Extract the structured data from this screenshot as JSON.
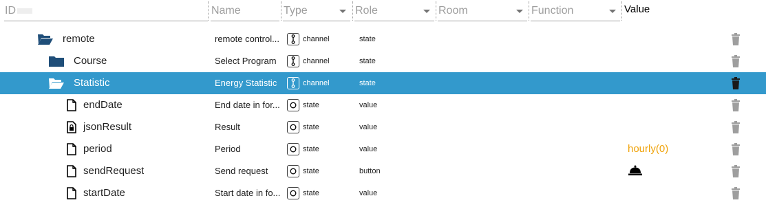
{
  "header": {
    "id_label": "ID",
    "name_label": "Name",
    "type_label": "Type",
    "role_label": "Role",
    "room_label": "Room",
    "function_label": "Function",
    "value_label": "Value"
  },
  "colors": {
    "selected": "#3399cc",
    "folder": "#1f4e79",
    "value_accent": "#f0a30a",
    "trash": "#9e9e9e"
  },
  "rows": [
    {
      "id": "remote",
      "icon": "folder-open-icon",
      "name": "remote control...",
      "type": "channel",
      "role": "state",
      "value": ""
    },
    {
      "id": "Course",
      "icon": "folder-icon",
      "name": "Select Program",
      "type": "channel",
      "role": "state",
      "value": ""
    },
    {
      "id": "Statistic",
      "icon": "folder-open-icon",
      "name": "Energy Statistic",
      "type": "channel",
      "role": "state",
      "value": "",
      "selected": true
    },
    {
      "id": "endDate",
      "icon": "file-icon",
      "name": "End date in for...",
      "type": "state",
      "role": "value",
      "value": ""
    },
    {
      "id": "jsonResult",
      "icon": "file-lock-icon",
      "name": "Result",
      "type": "state",
      "role": "value",
      "value": ""
    },
    {
      "id": "period",
      "icon": "file-icon",
      "name": "Period",
      "type": "state",
      "role": "value",
      "value": "hourly(0)"
    },
    {
      "id": "sendRequest",
      "icon": "file-icon",
      "name": "Send request",
      "type": "state",
      "role": "button",
      "value": "",
      "value_icon": "bell-icon"
    },
    {
      "id": "startDate",
      "icon": "file-icon",
      "name": "Start date in fo...",
      "type": "state",
      "role": "value",
      "value": ""
    }
  ]
}
